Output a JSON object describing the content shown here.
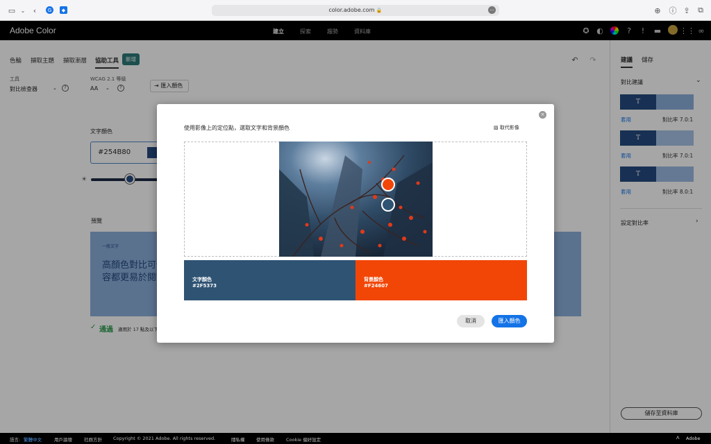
{
  "browser": {
    "url": "color.adobe.com"
  },
  "app": {
    "brand": "Adobe Color",
    "nav": [
      "建立",
      "探索",
      "趨勢",
      "資料庫"
    ]
  },
  "tabs": [
    "色輪",
    "擷取主題",
    "擷取漸層",
    "協助工具",
    "新增"
  ],
  "tool": {
    "tool_label": "工具",
    "tool_value": "對比檢查器",
    "wcag_label": "WCAG 2.1 等級",
    "wcag_value": "AA",
    "import_label": "匯入顏色"
  },
  "text_color": {
    "label": "文字顏色",
    "value": "#254B80"
  },
  "preview": {
    "label": "預覽",
    "small_label": "一般文字",
    "text_line1": "高顏色對比可使",
    "text_line2": "容都更易於閱讀",
    "pass_label": "通過",
    "pass_note": "適用於 17 點及以下"
  },
  "right_panel": {
    "tabs": [
      "建議",
      "儲存"
    ],
    "contrast_suggest": "對比建議",
    "suggestions": [
      {
        "t": "T",
        "apply": "套用",
        "ratio": "對比率 7.0:1",
        "bg": "#8db0dc"
      },
      {
        "t": "T",
        "apply": "套用",
        "ratio": "對比率 7.0:1",
        "bg": "#a8c3e6"
      },
      {
        "t": "T",
        "apply": "套用",
        "ratio": "對比率 8.0:1",
        "bg": "#9dbbe3"
      }
    ],
    "set_ratio": "設定對比率",
    "save_button": "儲存至資料庫"
  },
  "modal": {
    "instruction": "使用影像上的定位點，選取文字和背景顏色",
    "replace_image": "取代影像",
    "text_swatch": {
      "label": "文字顏色",
      "hex": "#2F5373",
      "color": "#2f5373"
    },
    "bg_swatch": {
      "label": "背景顏色",
      "hex": "#F24607",
      "color": "#f24607"
    },
    "cancel": "取消",
    "import": "匯入顏色"
  },
  "footer": {
    "language_label": "語言:",
    "language": "繁體中文",
    "links": [
      "用戶論壇",
      "社群方針",
      "Copyright © 2021 Adobe. All rights reserved.",
      "隱私權",
      "使用條款",
      "Cookie 偏好設定"
    ],
    "adobe": "Adobe"
  }
}
